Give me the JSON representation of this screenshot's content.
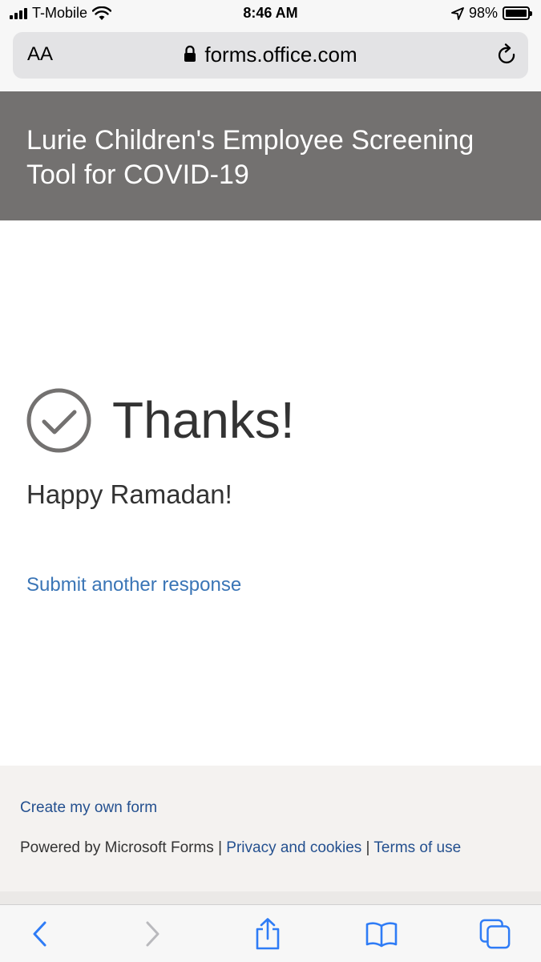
{
  "status_bar": {
    "carrier": "T-Mobile",
    "time": "8:46 AM",
    "battery": "98%",
    "icons": [
      "signal-icon",
      "wifi-icon",
      "location-icon",
      "battery-icon"
    ]
  },
  "address_bar": {
    "text_size_label": "AA",
    "url": "forms.office.com",
    "icons": [
      "lock-icon",
      "reload-icon"
    ]
  },
  "form": {
    "title": "Lurie Children's Employee Screening Tool for COVID-19",
    "thanks": "Thanks!",
    "message": "Happy Ramadan!",
    "submit_another": "Submit another response"
  },
  "footer": {
    "create_form": "Create my own form",
    "powered_by": "Powered by Microsoft Forms",
    "separator": "|",
    "privacy": "Privacy and cookies",
    "terms": "Terms of use"
  },
  "toolbar": {
    "icons": [
      "back-icon",
      "forward-icon",
      "share-icon",
      "bookmarks-icon",
      "tabs-icon"
    ]
  },
  "colors": {
    "header_bg": "#737170",
    "link": "#3a75b6",
    "footer_link": "#24508f",
    "footer_bg": "#f4f2f0",
    "ios_blue": "#2f7cf6"
  }
}
